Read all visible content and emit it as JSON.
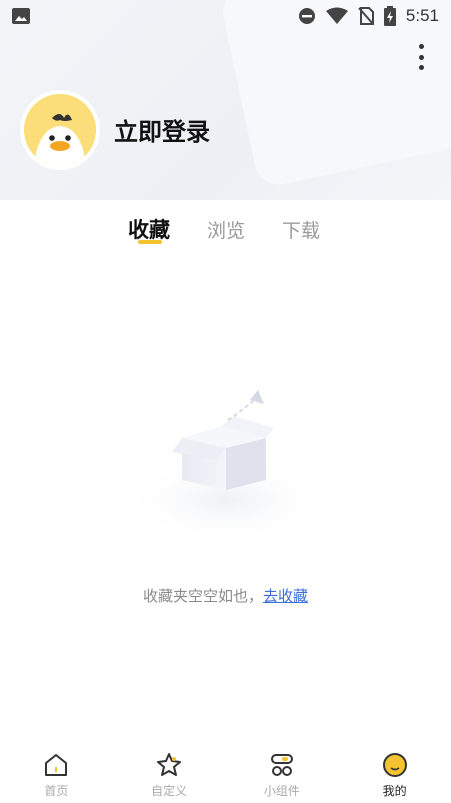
{
  "status_bar": {
    "time": "5:51",
    "left_icon": "image-icon",
    "icons": [
      "dnd-icon",
      "wifi-icon",
      "no-sim-icon",
      "battery-charging-icon"
    ]
  },
  "header": {
    "menu_icon": "more-vert-icon",
    "login_label": "立即登录",
    "avatar_icon": "duck-avatar-icon"
  },
  "tabs": [
    {
      "label": "收藏",
      "active": true
    },
    {
      "label": "浏览",
      "active": false
    },
    {
      "label": "下载",
      "active": false
    }
  ],
  "empty_state": {
    "message": "收藏夹空空如也，",
    "link": "去收藏",
    "illustration": "empty-box-icon"
  },
  "bottom_nav": [
    {
      "label": "首页",
      "icon": "home-icon",
      "active": false
    },
    {
      "label": "自定义",
      "icon": "star-icon",
      "active": false
    },
    {
      "label": "小组件",
      "icon": "widget-icon",
      "active": false
    },
    {
      "label": "我的",
      "icon": "profile-icon",
      "active": true
    }
  ],
  "colors": {
    "accent": "#f4c430",
    "link": "#3a6fd8",
    "avatar_bg": "#fbde79"
  }
}
